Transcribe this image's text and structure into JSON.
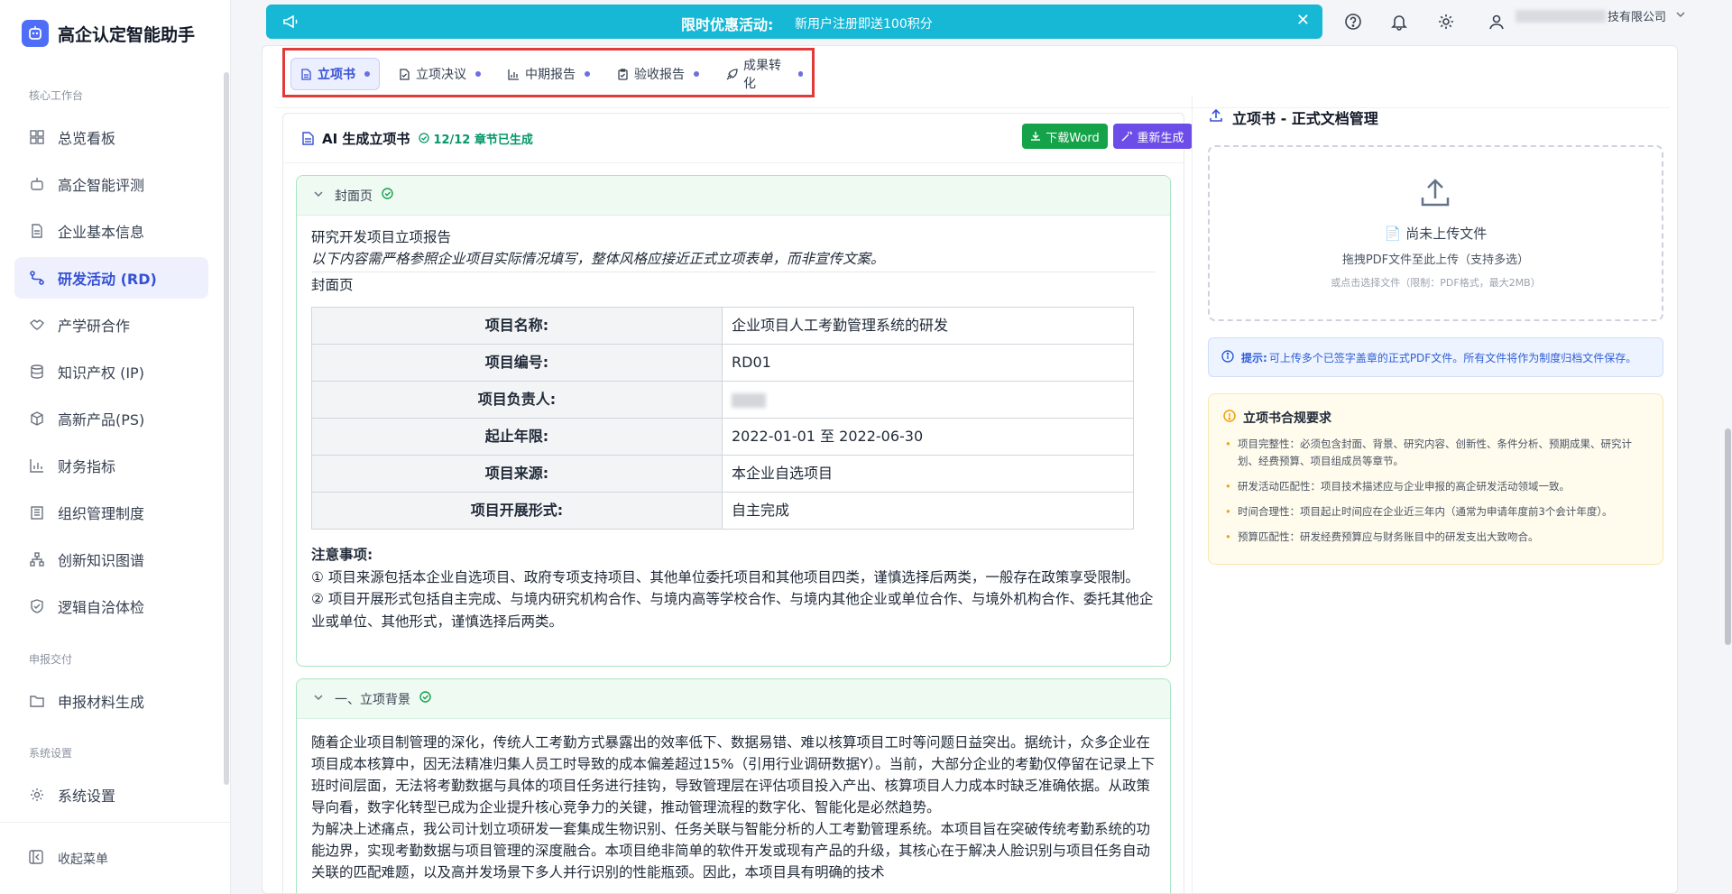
{
  "app": {
    "title": "高企认定智能助手"
  },
  "sidebar": {
    "sections": {
      "core": "核心工作台",
      "deliver": "申报交付",
      "settings": "系统设置"
    },
    "items": [
      {
        "label": "总览看板"
      },
      {
        "label": "高企智能评测"
      },
      {
        "label": "企业基本信息"
      },
      {
        "label": "研发活动 (RD)"
      },
      {
        "label": "产学研合作"
      },
      {
        "label": "知识产权 (IP)"
      },
      {
        "label": "高新产品(PS)"
      },
      {
        "label": "财务指标"
      },
      {
        "label": "组织管理制度"
      },
      {
        "label": "创新知识图谱"
      },
      {
        "label": "逻辑自洽体检"
      },
      {
        "label": "申报材料生成"
      },
      {
        "label": "系统设置"
      }
    ],
    "collapse_label": "收起菜单"
  },
  "banner": {
    "title": "限时优惠活动:",
    "text": "新用户注册即送100积分",
    "close": "✕"
  },
  "header": {
    "company_suffix": "技有限公司"
  },
  "tabs": [
    {
      "label": "立项书"
    },
    {
      "label": "立项决议"
    },
    {
      "label": "中期报告"
    },
    {
      "label": "验收报告"
    },
    {
      "label": "成果转化"
    }
  ],
  "ai": {
    "title": "AI 生成立项书",
    "status": "12/12 章节已生成",
    "download_label": "下载Word",
    "regen_label": "重新生成"
  },
  "cover": {
    "section_title": "封面页",
    "doc_title": "研究开发项目立项报告",
    "instruction": "以下内容需严格参照企业项目实际情况填写，整体风格应接近正式立项表单，而非宣传文案。",
    "page_label": "封面页",
    "rows": [
      {
        "k": "项目名称:",
        "v": "企业项目人工考勤管理系统的研发"
      },
      {
        "k": "项目编号:",
        "v": "RD01"
      },
      {
        "k": "项目负责人:",
        "v": ""
      },
      {
        "k": "起止年限:",
        "v": "2022-01-01 至 2022-06-30"
      },
      {
        "k": "项目来源:",
        "v": "本企业自选项目"
      },
      {
        "k": "项目开展形式:",
        "v": "自主完成"
      }
    ],
    "notes_title": "注意事项:",
    "note1": "① 项目来源包括本企业自选项目、政府专项支持项目、其他单位委托项目和其他项目四类，谨慎选择后两类，一般存在政策享受限制。",
    "note2": "② 项目开展形式包括自主完成、与境内研究机构合作、与境内高等学校合作、与境内其他企业或单位合作、与境外机构合作、委托其他企业或单位、其他形式，谨慎选择后两类。"
  },
  "background": {
    "section_title": "一、立项背景",
    "p1": "随着企业项目制管理的深化，传统人工考勤方式暴露出的效率低下、数据易错、难以核算项目工时等问题日益突出。据统计，众多企业在项目成本核算中，因无法精准归集人员工时导致的成本偏差超过15%（引用行业调研数据Y）。当前，大部分企业的考勤仅停留在记录上下班时间层面，无法将考勤数据与具体的项目任务进行挂钩，导致管理层在评估项目投入产出、核算项目人力成本时缺乏准确依据。从政策导向看，数字化转型已成为企业提升核心竞争力的关键，推动管理流程的数字化、智能化是必然趋势。",
    "p2": "为解决上述痛点，我公司计划立项研发一套集成生物识别、任务关联与智能分析的人工考勤管理系统。本项目旨在突破传统考勤系统的功能边界，实现考勤数据与项目管理的深度融合。本项目绝非简单的软件开发或现有产品的升级，其核心在于解决人脸识别与项目任务自动关联的匹配难题，以及高并发场景下多人并行识别的性能瓶颈。因此，本项目具有明确的技术"
  },
  "upload": {
    "title": "立项书 - 正式文档管理",
    "empty": "尚未上传文件",
    "drag_hint": "拖拽PDF文件至此上传（支持多选）",
    "click_hint": "或点击选择文件（限制：PDF格式，最大2MB）",
    "tip_label": "提示:",
    "tip_text": "可上传多个已签字盖章的正式PDF文件。所有文件将作为制度归档文件保存。"
  },
  "compliance": {
    "title": "立项书合规要求",
    "items": [
      "项目完整性：必须包含封面、背景、研究内容、创新性、条件分析、预期成果、研究计划、经费预算、项目组成员等章节。",
      "研发活动匹配性：项目技术描述应与企业申报的高企研发活动领域一致。",
      "时间合理性：项目起止时间应在企业近三年内（通常为申请年度前3个会计年度）。",
      "预算匹配性：研发经费预算应与财务账目中的研发支出大致吻合。"
    ]
  },
  "colors": {
    "accent": "#3651d4",
    "banner": "#16b8d6",
    "success": "#15a34a",
    "purple": "#6d4de8",
    "highlight": "#e03a3a"
  },
  "icons": {
    "logo": "robot-icon",
    "banner": "megaphone-icon",
    "help": "help-circle-icon",
    "bell": "bell-icon",
    "settings": "gear-icon",
    "user": "user-icon"
  }
}
